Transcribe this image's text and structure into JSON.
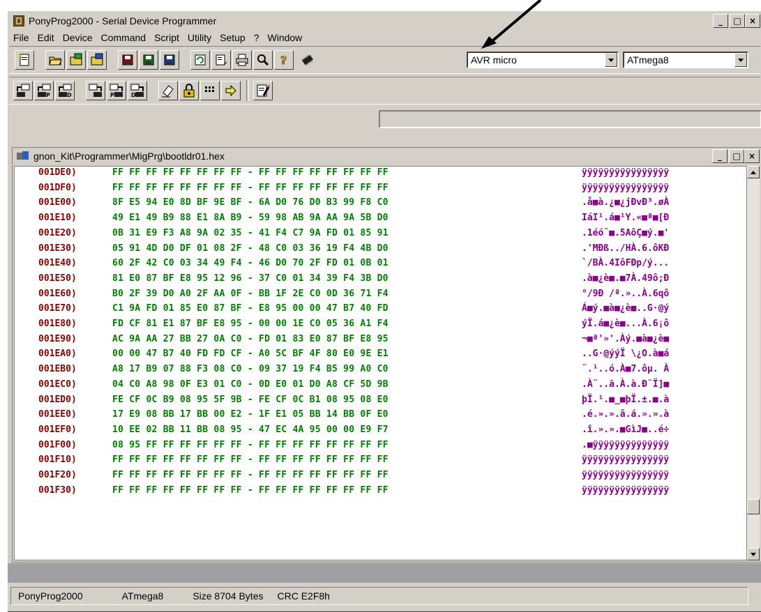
{
  "window": {
    "title": "PonyProg2000 - Serial Device Programmer",
    "controls": {
      "minimize": "_",
      "maximize": "□",
      "close": "×"
    }
  },
  "menu": [
    "File",
    "Edit",
    "Device",
    "Command",
    "Script",
    "Utility",
    "Setup",
    "?",
    "Window"
  ],
  "toolbar": {
    "device_family": "AVR micro",
    "device_model": "ATmega8",
    "icons_row1": [
      "new-file-icon",
      "open-icon",
      "open-program-icon",
      "open-data-icon",
      "save-icon",
      "save-program-icon",
      "save-data-icon",
      "reload-icon",
      "edit-buffer-icon",
      "print-icon",
      "setup-icon",
      "help-icon",
      "chip-icon"
    ],
    "icons_row2": [
      "read-all-icon",
      "read-program-icon",
      "read-data-icon",
      "write-all-icon",
      "write-program-icon",
      "write-data-icon",
      "erase-icon",
      "lock-bits-icon",
      "config-bits-icon",
      "program-icon",
      "script-icon"
    ]
  },
  "child_window": {
    "title": "gnon_Kit\\Programmer\\MigPrg\\bootldr01.hex",
    "controls": {
      "minimize": "_",
      "maximize": "□",
      "close": "×"
    }
  },
  "hex_rows": [
    {
      "addr": "001DE0)",
      "bytes": "FF FF FF FF FF FF FF FF - FF FF FF FF FF FF FF FF",
      "ascii": "ÿÿÿÿÿÿÿÿÿÿÿÿÿÿÿÿ"
    },
    {
      "addr": "001DF0)",
      "bytes": "FF FF FF FF FF FF FF FF - FF FF FF FF FF FF FF FF",
      "ascii": "ÿÿÿÿÿÿÿÿÿÿÿÿÿÿÿÿ"
    },
    {
      "addr": "001E00)",
      "bytes": "8F E5 94 E0 8D BF 9E BF - 6A D0 76 D0 B3 99 F8 C0",
      "ascii": ".å■à.¿■¿jÐvÐ³.øÀ"
    },
    {
      "addr": "001E10)",
      "bytes": "49 E1 49 B9 88 E1 8A B9 - 59 98 AB 9A AA 9A 5B D0",
      "ascii": "IáI¹.á■¹Y.«■ª■[Ð"
    },
    {
      "addr": "001E20)",
      "bytes": "0B 31 E9 F3 A8 9A 02 35 - 41 F4 C7 9A FD 01 85 91",
      "ascii": ".1éó¨■.5AôÇ■ý.■'"
    },
    {
      "addr": "001E30)",
      "bytes": "05 91 4D D0 DF 01 08 2F - 48 C0 03 36 19 F4 4B D0",
      "ascii": ".'MÐß../HÀ.6.ôKÐ"
    },
    {
      "addr": "001E40)",
      "bytes": "60 2F 42 C0 03 34 49 F4 - 46 D0 70 2F FD 01 0B 01",
      "ascii": "`/BÀ.4IôFÐp/ý..."
    },
    {
      "addr": "001E50)",
      "bytes": "81 E0 87 BF E8 95 12 96 - 37 C0 01 34 39 F4 3B D0",
      "ascii": ".à■¿è■.■7À.49ô;Ð"
    },
    {
      "addr": "001E60)",
      "bytes": "B0 2F 39 D0 A0 2F AA 0F - BB 1F 2E C0 0D 36 71 F4",
      "ascii": "°/9Ð /ª.»..À.6qô"
    },
    {
      "addr": "001E70)",
      "bytes": "C1 9A FD 01 85 E0 87 BF - E8 95 00 00 47 B7 40 FD",
      "ascii": "Á■ý.■à■¿è■..G·@ý"
    },
    {
      "addr": "001E80)",
      "bytes": "FD CF 81 E1 87 BF E8 95 - 00 00 1E C0 05 36 A1 F4",
      "ascii": "ýÏ.á■¿è■...À.6¡ô"
    },
    {
      "addr": "001E90)",
      "bytes": "AC 9A AA 27 BB 27 0A C0 - FD 01 83 E0 87 BF E8 95",
      "ascii": "¬■ª'»'.Àý.■à■¿è■"
    },
    {
      "addr": "001EA0)",
      "bytes": "00 00 47 B7 40 FD FD CF - A0 5C BF 4F 80 E0 9E E1",
      "ascii": "..G·@ýýÏ \\¿O.à■á"
    },
    {
      "addr": "001EB0)",
      "bytes": "A8 17 B9 07 88 F3 08 C0 - 09 37 19 F4 B5 99 A0 C0",
      "ascii": "¨.¹..ó.À■7.ôµ. À"
    },
    {
      "addr": "001EC0)",
      "bytes": "04 C0 A8 98 0F E3 01 C0 - 0D E0 01 D0 A8 CF 5D 9B",
      "ascii": ".À¨..ã.À.à.Ð¨Ï]■"
    },
    {
      "addr": "001ED0)",
      "bytes": "FE CF 0C B9 08 95 5F 9B - FE CF 0C B1 08 95 08 E0",
      "ascii": "þÏ.¹.■_■þÏ.±.■.à"
    },
    {
      "addr": "001EE0)",
      "bytes": "17 E9 08 BB 17 BB 00 E2 - 1F E1 05 BB 14 BB 0F E0",
      "ascii": ".é.».».â.á.».».à"
    },
    {
      "addr": "001EF0)",
      "bytes": "10 EE 02 BB 11 BB 08 95 - 47 EC 4A 95 00 00 E9 F7",
      "ascii": ".î.».».■GìJ■..é÷"
    },
    {
      "addr": "001F00)",
      "bytes": "08 95 FF FF FF FF FF FF - FF FF FF FF FF FF FF FF",
      "ascii": ".■ÿÿÿÿÿÿÿÿÿÿÿÿÿÿ"
    },
    {
      "addr": "001F10)",
      "bytes": "FF FF FF FF FF FF FF FF - FF FF FF FF FF FF FF FF",
      "ascii": "ÿÿÿÿÿÿÿÿÿÿÿÿÿÿÿÿ"
    },
    {
      "addr": "001F20)",
      "bytes": "FF FF FF FF FF FF FF FF - FF FF FF FF FF FF FF FF",
      "ascii": "ÿÿÿÿÿÿÿÿÿÿÿÿÿÿÿÿ"
    },
    {
      "addr": "001F30)",
      "bytes": "FF FF FF FF FF FF FF FF - FF FF FF FF FF FF FF FF",
      "ascii": "ÿÿÿÿÿÿÿÿÿÿÿÿÿÿÿÿ"
    }
  ],
  "status": {
    "app": "PonyProg2000",
    "device": "ATmega8",
    "size": "Size  8704 Bytes",
    "crc": "CRC  E2F8h"
  },
  "colors": {
    "address": "#900000",
    "bytes": "#008000",
    "ascii": "#8b008b",
    "face": "#d4d0c8"
  }
}
